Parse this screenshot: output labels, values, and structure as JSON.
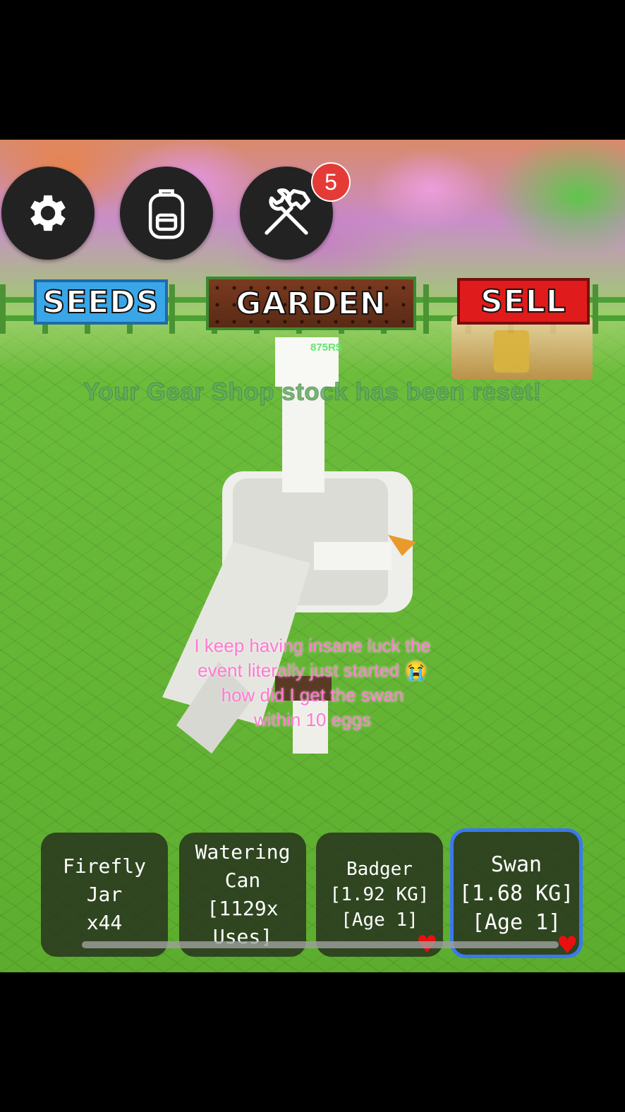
{
  "hud": {
    "settings_icon": "gear-icon",
    "backpack_icon": "backpack-icon",
    "tools_icon": "hammer-wrench-icon",
    "tools_badge_count": "5"
  },
  "nav": {
    "seeds_label": "SEEDS",
    "garden_label": "GARDEN",
    "sell_label": "SELL"
  },
  "world": {
    "price_tag": "875R$",
    "notification": "Your Gear Shop stock has been reset!"
  },
  "caption": {
    "lines": [
      "I keep having insane luck the",
      "event literally just started 😭",
      "how did I get the swan",
      "within 10 eggs"
    ]
  },
  "hotbar": {
    "slots": [
      {
        "lines": [
          "Firefly Jar",
          "x44"
        ],
        "favorited": false,
        "selected": false
      },
      {
        "lines": [
          "Watering",
          "Can",
          "[1129x",
          "Uses]"
        ],
        "favorited": false,
        "selected": false
      },
      {
        "lines": [
          "Badger",
          "[1.92 KG]",
          "[Age 1]"
        ],
        "favorited": true,
        "selected": false
      },
      {
        "lines": [
          "Swan",
          "[1.68 KG]",
          "[Age 1]"
        ],
        "favorited": true,
        "selected": true
      }
    ]
  },
  "colors": {
    "seeds": "#39a6e8",
    "sell": "#e01b1b",
    "garden": "#6b3219",
    "badge": "#e43b37",
    "caption": "#ff7ad0",
    "selected_border": "#3b78f0"
  }
}
